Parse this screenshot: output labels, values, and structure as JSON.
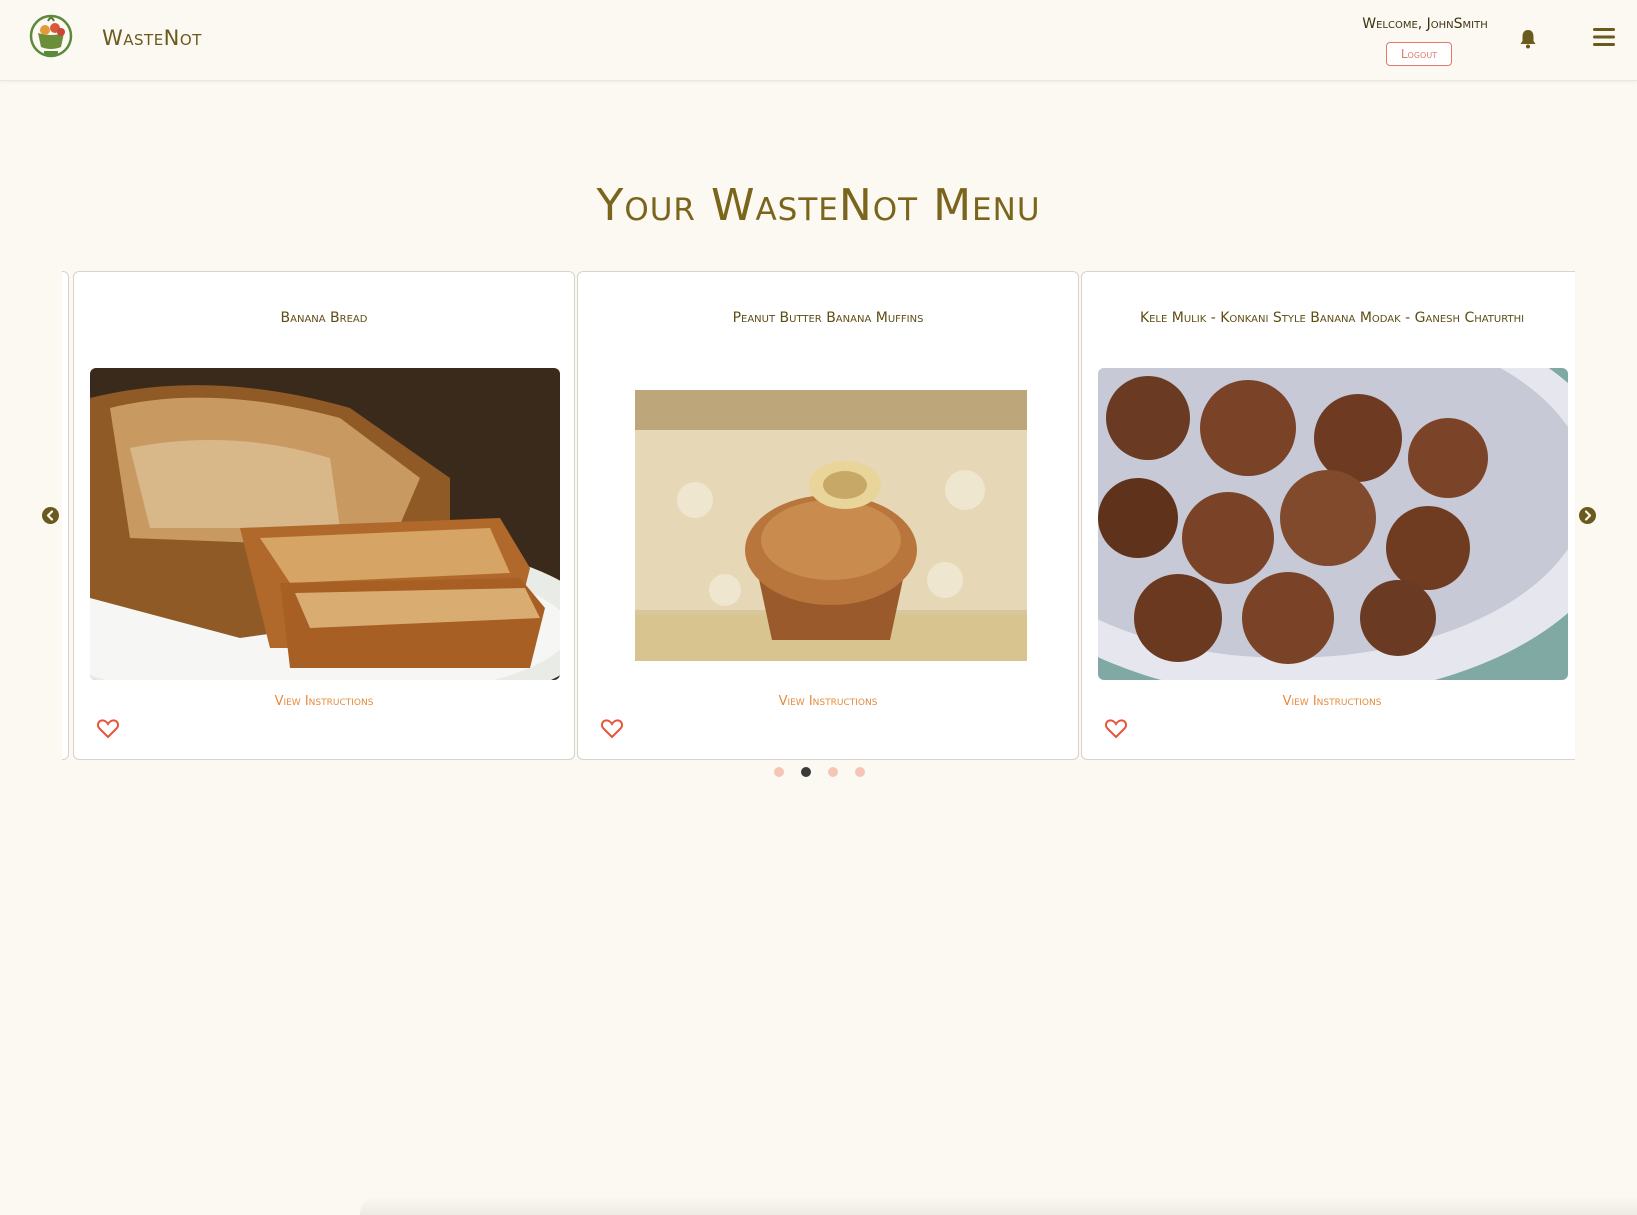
{
  "navbar": {
    "brand": "WasteNot",
    "logo_icon": "basket-logo-icon",
    "welcome": "Welcome, JohnSmith",
    "logout_label": "Logout",
    "bell_icon": "bell-icon",
    "menu_icon": "hamburger-menu-icon"
  },
  "page": {
    "title": "Your WasteNot Menu"
  },
  "carousel": {
    "prev_icon": "chevron-left-circle-icon",
    "next_icon": "chevron-right-circle-icon",
    "active_index": 2,
    "indicator_count": 4,
    "cards": [
      {
        "title": "Banana Bread",
        "image_icon": "banana-bread-photo",
        "link_label": "View Instructions",
        "favorite_icon": "heart-outline-icon"
      },
      {
        "title": "Peanut Butter Banana Muffins",
        "image_icon": "banana-muffin-photo",
        "link_label": "View Instructions",
        "favorite_icon": "heart-outline-icon"
      },
      {
        "title": "Kele Mulik - Konkani Style Banana Modak - Ganesh Chaturthi",
        "image_icon": "banana-fritters-bowl-photo",
        "link_label": "View Instructions",
        "favorite_icon": "heart-outline-icon"
      }
    ]
  },
  "colors": {
    "background": "#fcf8f2",
    "brand_text": "#6b5a1e",
    "accent_orange": "#e68a3c",
    "logout_red": "#e07a6a",
    "indicator_inactive": "#f5c6b6",
    "indicator_active": "#3a3a3a"
  }
}
